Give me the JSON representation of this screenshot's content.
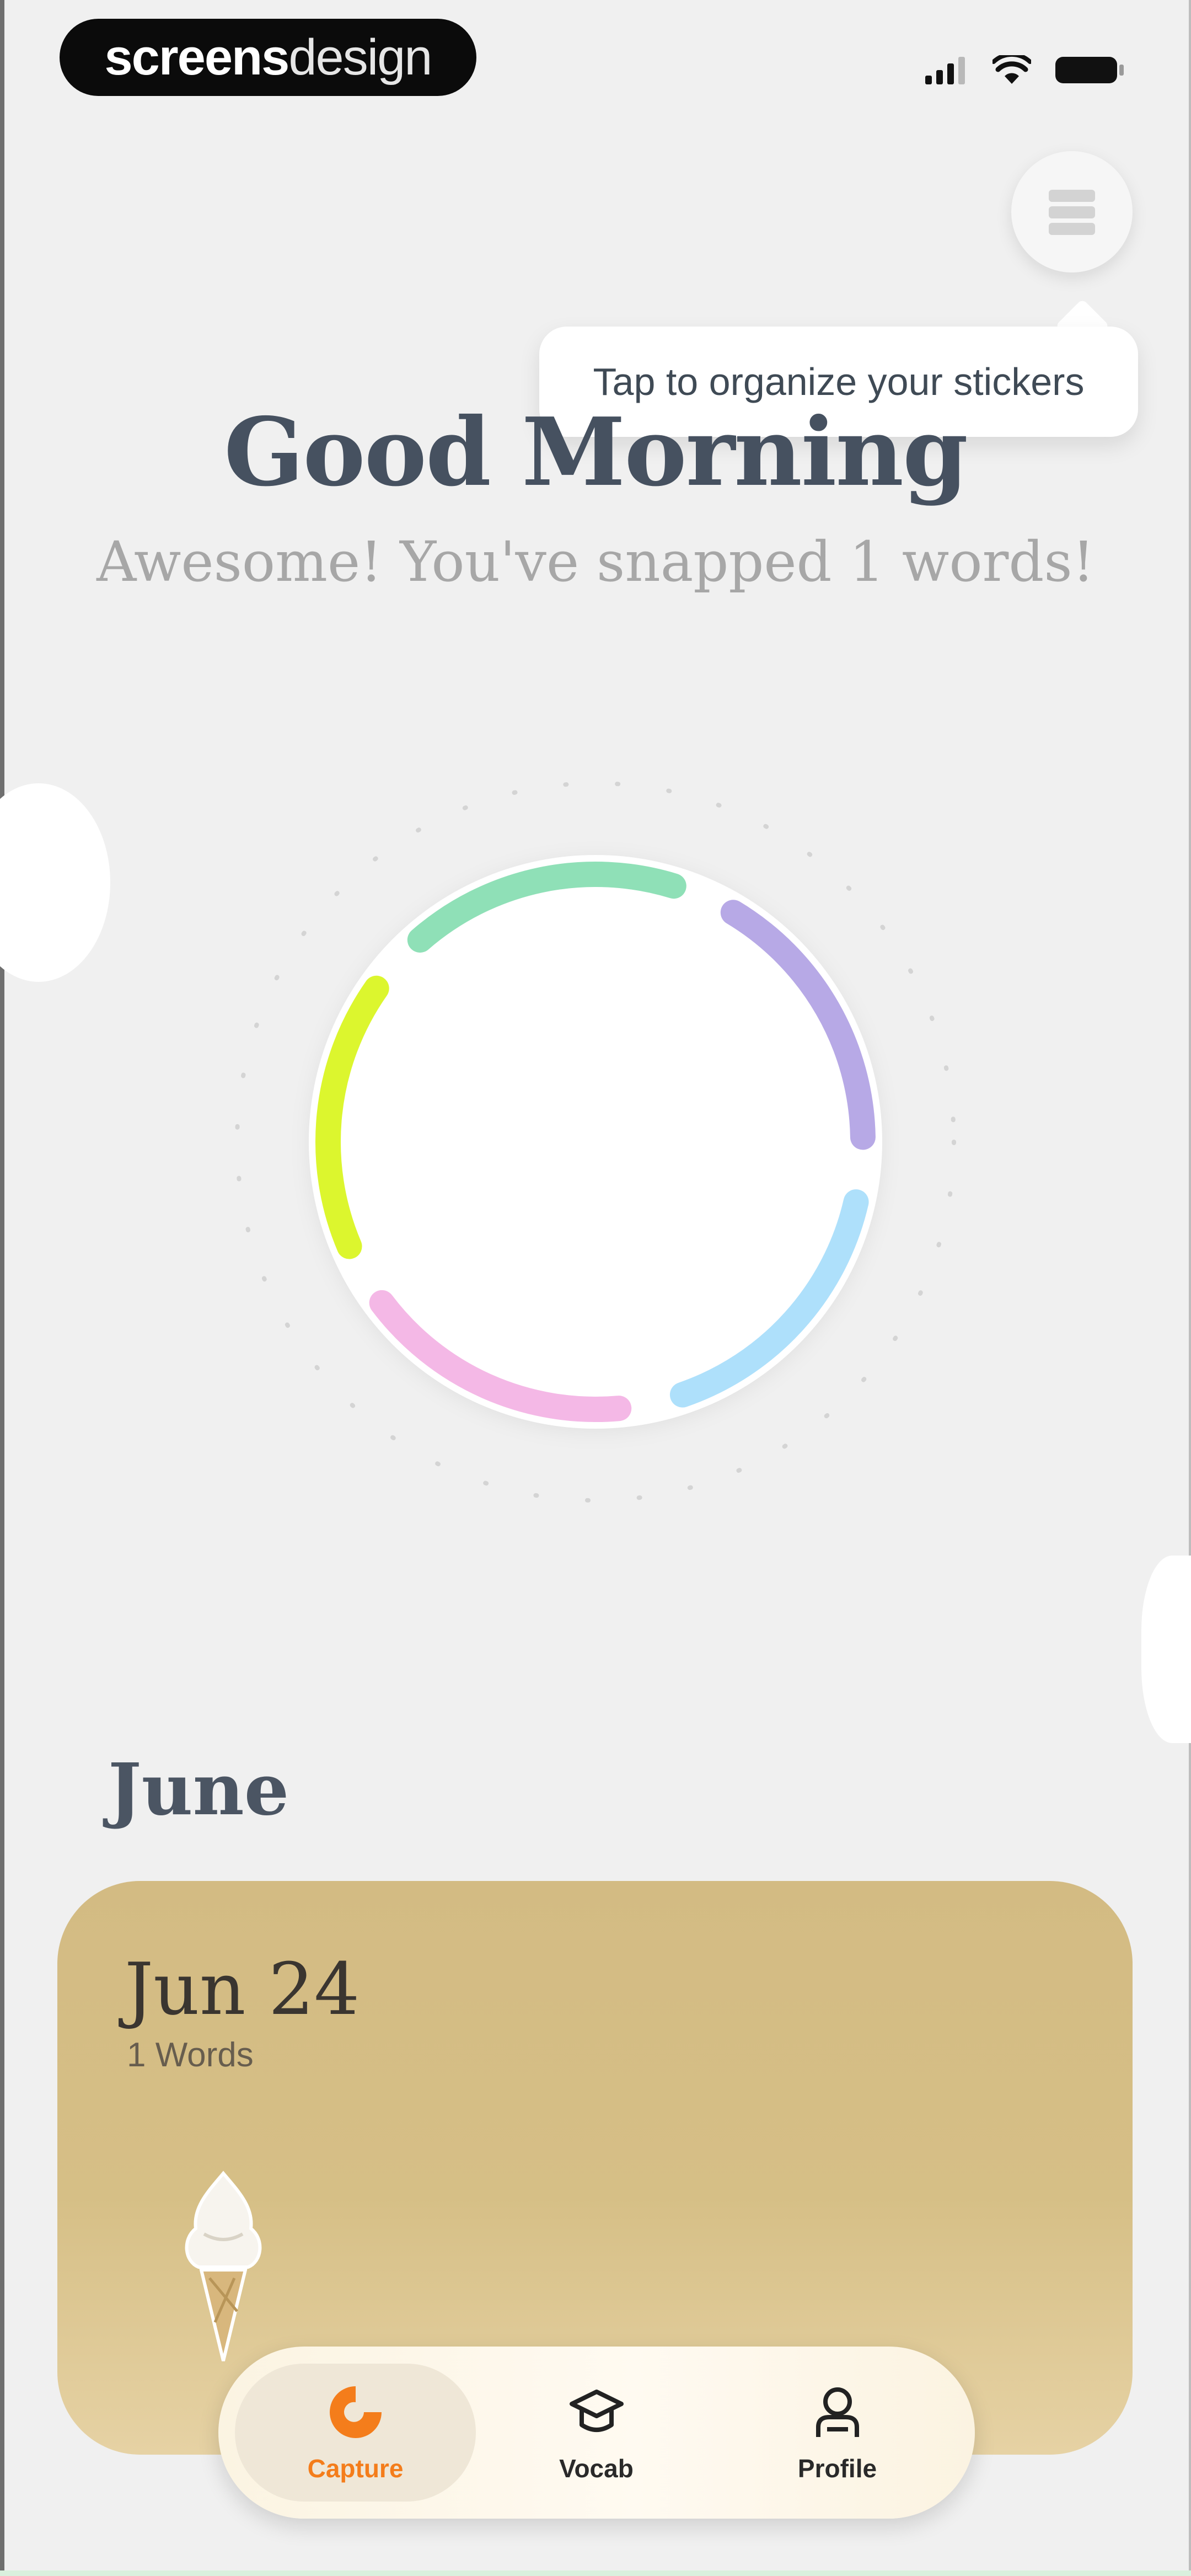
{
  "status_bar": {
    "watermark_bold": "screens",
    "watermark_light": "design"
  },
  "header": {
    "menu_icon": "stack-icon",
    "tooltip_text": "Tap to organize your stickers"
  },
  "greeting": {
    "title": "Good Morning",
    "subtitle": "Awesome! You've snapped 1 words!"
  },
  "ring": {
    "segment_colors": [
      "#dcf62e",
      "#8fe0b7",
      "#b7a9e6",
      "#aee0fb",
      "#f4b8e6"
    ]
  },
  "timeline": {
    "month": "June",
    "days": [
      {
        "date": "Jun 24",
        "count_label": "1 Words",
        "sticker": "ice-cream-sticker"
      }
    ]
  },
  "tabs": [
    {
      "label": "Capture",
      "icon": "capture-icon",
      "active": true
    },
    {
      "label": "Vocab",
      "icon": "graduation-cap-icon",
      "active": false
    },
    {
      "label": "Profile",
      "icon": "person-icon",
      "active": false
    }
  ],
  "colors": {
    "accent": "#f47d1b",
    "card": "#d6bf86",
    "title": "#465160"
  }
}
